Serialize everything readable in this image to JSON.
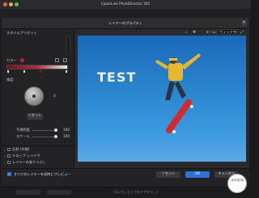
{
  "window": {
    "title": "CyberLink PhotoDirector 365"
  },
  "dialog": {
    "title": "レイヤーのプロパティ",
    "zoom_prefix": "ズーム:",
    "zoom_value": "ウィンドウ",
    "left": {
      "style_label": "スタイルプリセット",
      "color_label": "カラー",
      "direction_label": "角度",
      "angle_value": "0",
      "reset_label": "リセット",
      "opacity_label": "不透明度",
      "opacity_value": "100",
      "scale_label": "スケール",
      "scale_value": "100",
      "sections": [
        "反射 (外側)",
        "ドロップ シャドウ",
        "レイヤーの塗りつぶし"
      ]
    },
    "preview_text": "TEST",
    "footer": {
      "checkbox_label": "すべてのレイヤーを同時にプレビュー",
      "reset_button": "リセット",
      "ok_button": "OK",
      "cancel_button": "キャンセル"
    }
  },
  "bottom_bar": {
    "text": "コレクション (ライブラリ...)"
  },
  "watermark": {
    "text": "まのおね"
  },
  "colors": {
    "accent": "#2f72d6",
    "sky_top": "#1b69b8",
    "sky_bottom": "#5aa9e6",
    "gradient_stop": "#7a1020"
  }
}
